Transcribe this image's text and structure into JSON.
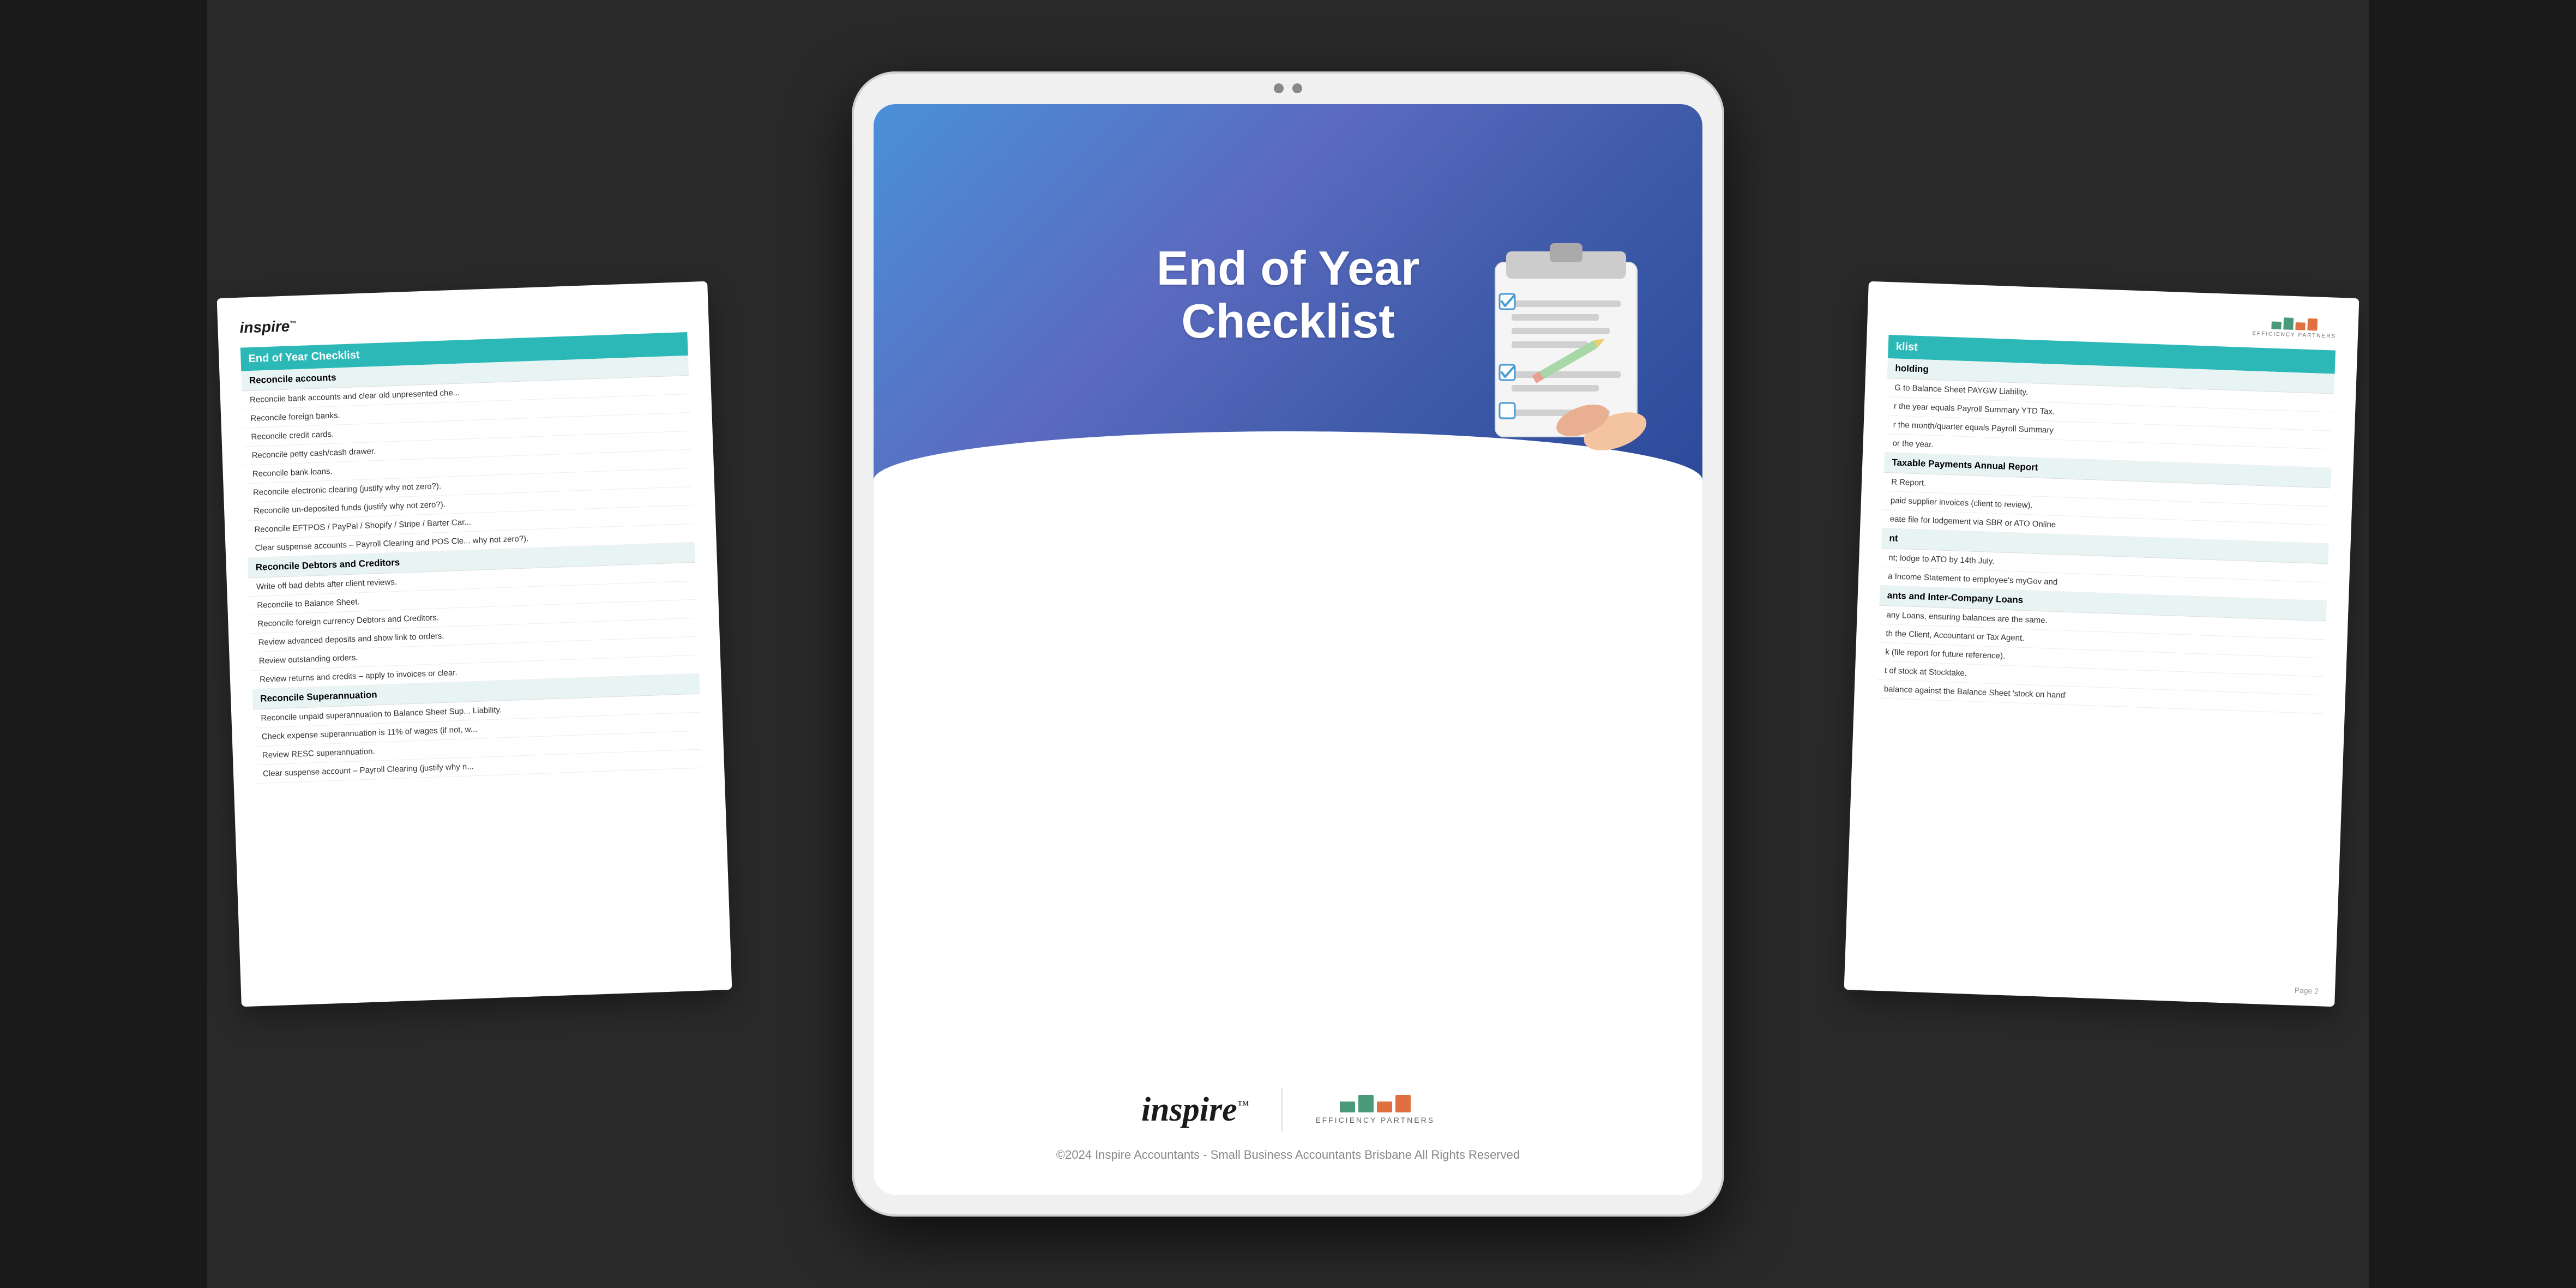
{
  "tablet": {
    "cover": {
      "title_line1": "End of Year",
      "title_line2": "Checklist",
      "footer_text": "©2024 Inspire Accountants - Small Business Accountants Brisbane All Rights Reserved",
      "inspire_logo": "inspire",
      "inspire_logo_tm": "™",
      "ep_text": "EFFICIENCY PARTNERS"
    }
  },
  "left_page": {
    "logo": "inspire",
    "logo_tm": "™",
    "checklist_header": "End of Year Checklist",
    "sections": [
      {
        "title": "Reconcile accounts",
        "items": [
          "Reconcile bank accounts and clear old unpresented che...",
          "Reconcile foreign banks.",
          "Reconcile credit cards.",
          "Reconcile petty cash/cash drawer.",
          "Reconcile bank loans.",
          "Reconcile electronic clearing (justify why not zero?).",
          "Reconcile un-deposited funds (justify why not zero?).",
          "Reconcile EFTPOS / PayPal / Shopify / Stripe / Barter Car...",
          "Clear suspense accounts – Payroll Clearing and POS Cle... why not zero?)."
        ]
      },
      {
        "title": "Reconcile Debtors and Creditors",
        "items": [
          "Write off bad debts after client reviews.",
          "Reconcile to Balance Sheet.",
          "Reconcile foreign currency Debtors and Creditors.",
          "Review advanced deposits and show link to orders.",
          "Review outstanding orders.",
          "Review returns and credits – apply to invoices or clear."
        ]
      },
      {
        "title": "Reconcile Superannuation",
        "items": [
          "Reconcile unpaid superannuation to Balance Sheet Sup... Liability.",
          "Check expense superannuation is 11% of wages (if not, w...",
          "Review RESC superannuation.",
          "Clear suspense account – Payroll Clearing (justify why n..."
        ]
      }
    ]
  },
  "right_page": {
    "ep_text": "EFFICIENCY PARTNERS",
    "checklist_header": "klist",
    "sections": [
      {
        "title": "holding",
        "items": [
          "G to Balance Sheet PAYGW Liability.",
          "r the year equals Payroll Summary YTD Tax.",
          "r the month/quarter equals Payroll Summary"
        ]
      },
      {
        "title": "",
        "items": [
          "or the year."
        ]
      },
      {
        "title": "Taxable Payments Annual Report",
        "items": [
          "R Report.",
          "paid supplier invoices (client to review).",
          "eate file for lodgement via SBR or ATO Online"
        ]
      },
      {
        "title": "nt",
        "items": [
          "nt; lodge to ATO by 14th July.",
          "a Income Statement to employee's myGov and"
        ]
      },
      {
        "title": "ants and Inter-Company Loans",
        "items": [
          "any Loans, ensuring balances are the same.",
          "th the Client, Accountant or Tax Agent."
        ]
      },
      {
        "title": "",
        "items": [
          "k (file report for future reference).",
          "t of stock at Stocktake.",
          "balance against the Balance Sheet 'stock on hand'"
        ]
      }
    ],
    "page_number": "Page 2"
  }
}
